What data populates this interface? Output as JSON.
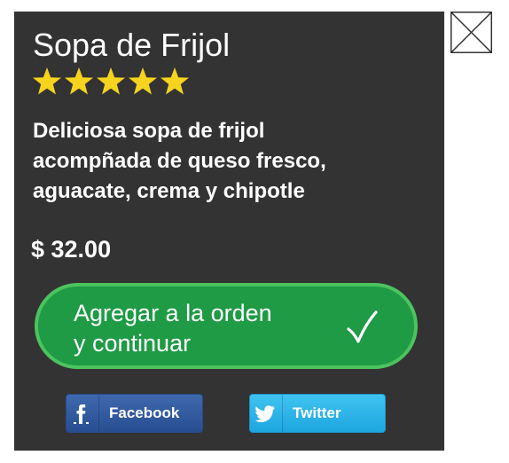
{
  "product": {
    "title": "Sopa de Frijol",
    "rating": 5,
    "rating_max": 5,
    "description_lines": [
      "Deliciosa sopa de frijol",
      "acompñada de queso fresco,",
      "aguacate, crema y chipotle"
    ],
    "price": "$ 32.00"
  },
  "cta": {
    "label_lines": [
      "Agregar a la orden",
      "y continuar"
    ],
    "icon": "checkmark-icon"
  },
  "share": {
    "facebook_label": "Facebook",
    "twitter_label": "Twitter",
    "facebook_icon": "facebook-icon",
    "twitter_icon": "twitter-icon"
  },
  "close": {
    "icon": "close-icon"
  },
  "colors": {
    "modal_bg": "#333333",
    "star": "#f5d31e",
    "cta_bg": "#1f9a45",
    "cta_border": "#4cc35f",
    "facebook": "#3b5b9a",
    "twitter": "#2fb5ea"
  }
}
